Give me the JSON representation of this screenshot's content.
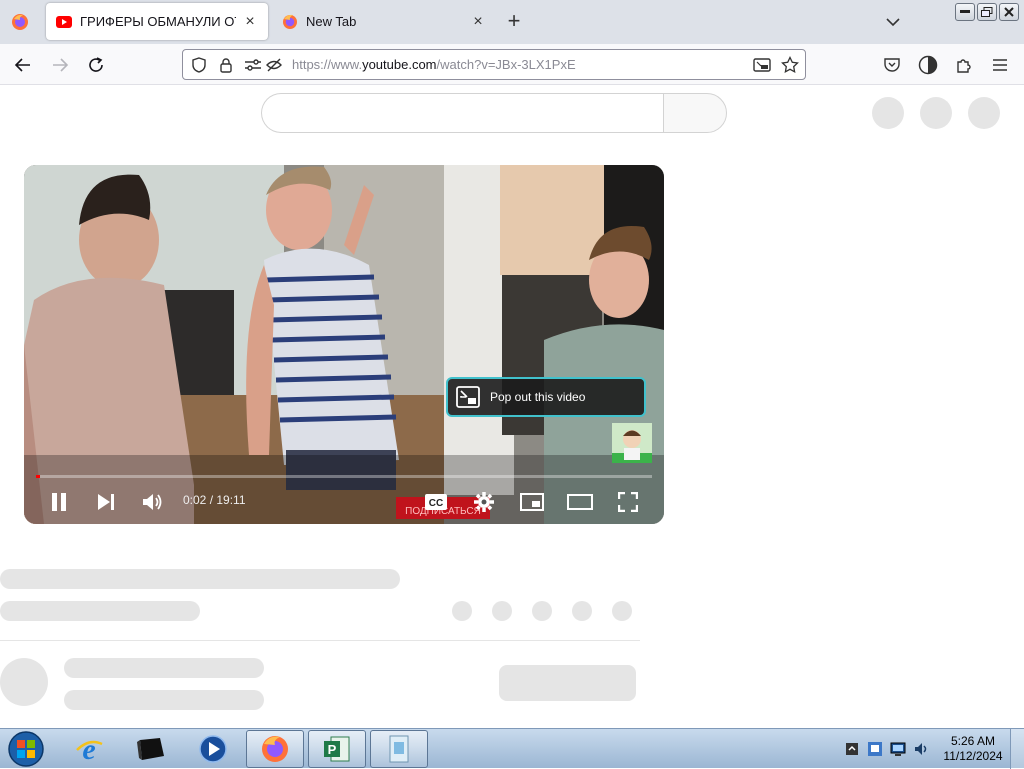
{
  "browser": {
    "tabs": [
      {
        "title": "ГРИФЕРЫ ОБМАНУЛИ ОТЦА И",
        "favicon": "youtube-icon",
        "active": true
      },
      {
        "title": "New Tab",
        "favicon": "firefox-icon",
        "active": false
      }
    ],
    "url": {
      "prefix": "https://www.",
      "host": "youtube.com",
      "path": "/watch?v=JBx-3LX1PxE"
    }
  },
  "player": {
    "popout_tooltip": "Pop out this video",
    "time_display": "0:02 / 19:11",
    "progress": 0.002,
    "cc_label": "CC",
    "overlay_badge": "ПОДПИСАТЬСЯ"
  },
  "taskbar": {
    "apps": [
      "internet-explorer-icon",
      "terminal-icon",
      "media-player-icon",
      "firefox-icon",
      "publisher-icon",
      "file-manager-icon"
    ],
    "clock": {
      "time": "5:26 AM",
      "date": "11/12/2024"
    }
  },
  "colors": {
    "accent_focus": "#41c1cc",
    "youtube_red": "#ff0000",
    "tab_strip": "#dde1e8"
  }
}
